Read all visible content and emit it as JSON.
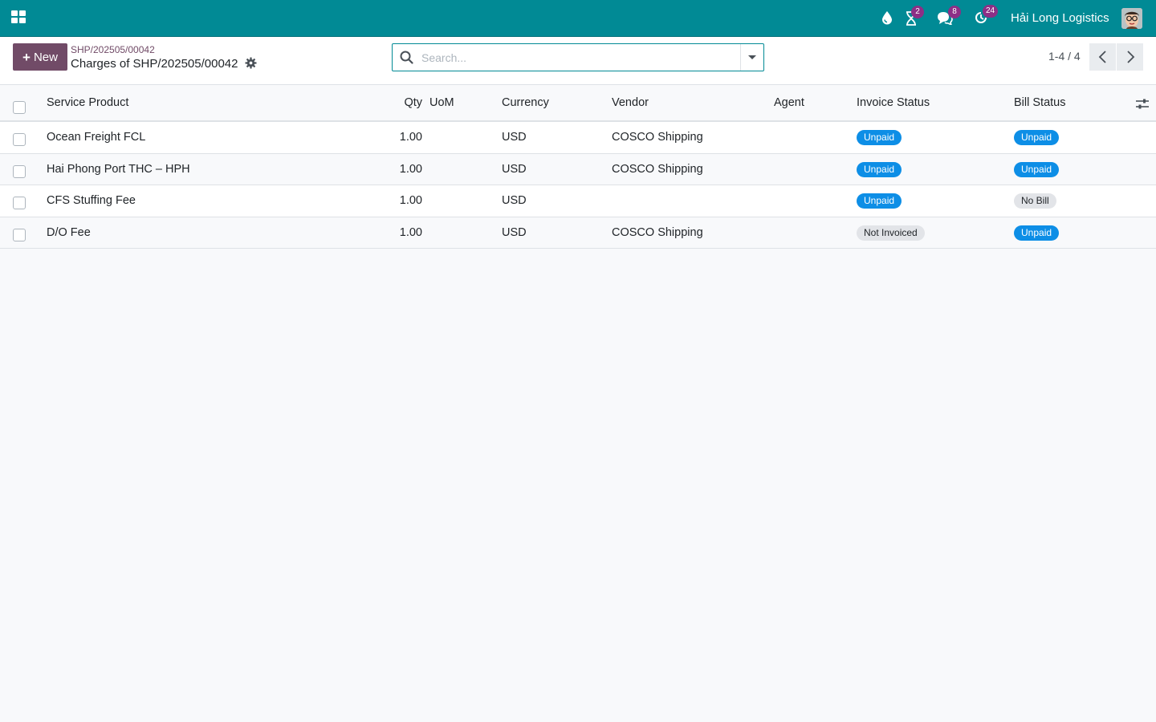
{
  "navbar": {
    "company": "Hải Long Logistics",
    "activity_count": "2",
    "messages_count": "8",
    "updates_count": "24"
  },
  "control": {
    "new_label": "New",
    "breadcrumb": "SHP/202505/00042",
    "title": "Charges of SHP/202505/00042",
    "search_placeholder": "Search...",
    "pager": "1-4 / 4"
  },
  "table": {
    "headers": {
      "product": "Service Product",
      "qty": "Qty",
      "uom": "UoM",
      "currency": "Currency",
      "vendor": "Vendor",
      "agent": "Agent",
      "invoice": "Invoice Status",
      "bill": "Bill Status"
    },
    "rows": [
      {
        "product": "Ocean Freight FCL",
        "qty": "1.00",
        "uom": "",
        "currency": "USD",
        "vendor": "COSCO Shipping",
        "agent": "",
        "invoice": "Unpaid",
        "bill": "Unpaid"
      },
      {
        "product": "Hai Phong Port THC – HPH",
        "qty": "1.00",
        "uom": "",
        "currency": "USD",
        "vendor": "COSCO Shipping",
        "agent": "",
        "invoice": "Unpaid",
        "bill": "Unpaid"
      },
      {
        "product": "CFS Stuffing Fee",
        "qty": "1.00",
        "uom": "",
        "currency": "USD",
        "vendor": "",
        "agent": "",
        "invoice": "Unpaid",
        "bill": "No Bill"
      },
      {
        "product": "D/O Fee",
        "qty": "1.00",
        "uom": "",
        "currency": "USD",
        "vendor": "COSCO Shipping",
        "agent": "",
        "invoice": "Not Invoiced",
        "bill": "Unpaid"
      }
    ]
  },
  "colors": {
    "navbar": "#018a95",
    "primary": "#714b67",
    "badge": "#8d2f86",
    "status_info": "#0d8ee6",
    "status_muted": "#e2e4e8"
  }
}
